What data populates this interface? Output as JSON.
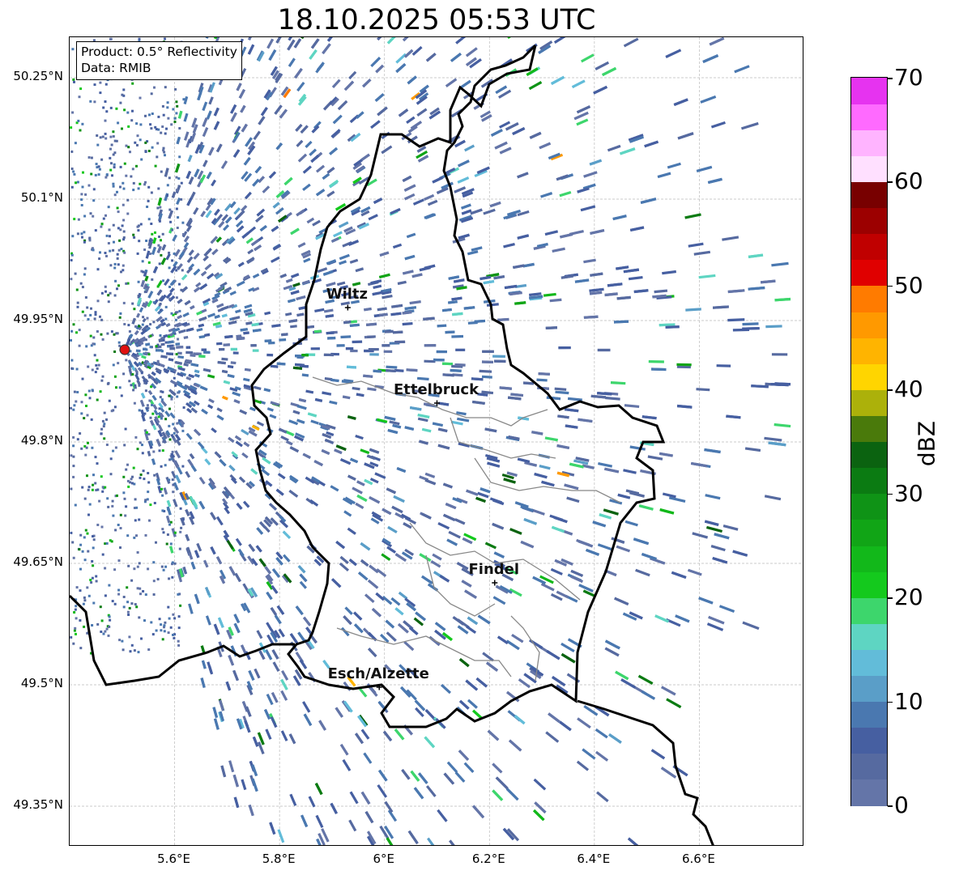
{
  "title": "18.10.2025 05:53 UTC",
  "info_box": {
    "product": "Product: 0.5° Reflectivity",
    "source": "Data: RMIB"
  },
  "axes": {
    "lon_ticks": [
      "5.6°E",
      "5.8°E",
      "6°E",
      "6.2°E",
      "6.4°E",
      "6.6°E"
    ],
    "lat_ticks": [
      "50.25°N",
      "50.1°N",
      "49.95°N",
      "49.8°N",
      "49.65°N",
      "49.5°N",
      "49.35°N"
    ],
    "lon_values": [
      5.6,
      5.8,
      6.0,
      6.2,
      6.4,
      6.6
    ],
    "lat_values": [
      50.25,
      50.1,
      49.95,
      49.8,
      49.65,
      49.5,
      49.35
    ],
    "lon_range": [
      5.4,
      6.8
    ],
    "lat_range": [
      49.3,
      50.3
    ],
    "grid": true
  },
  "radar_site": {
    "lon": 5.505,
    "lat": 49.914
  },
  "cities": [
    {
      "name": "Wiltz",
      "lon": 5.93,
      "lat": 49.966
    },
    {
      "name": "Ettelbruck",
      "lon": 6.1,
      "lat": 49.848
    },
    {
      "name": "Findel",
      "lon": 6.21,
      "lat": 49.626
    },
    {
      "name": "Esch/Alzette",
      "lon": 5.99,
      "lat": 49.497
    }
  ],
  "colorbar": {
    "label": "dBZ",
    "ticks": [
      "0",
      "10",
      "20",
      "30",
      "40",
      "50",
      "60",
      "70"
    ],
    "range": [
      0,
      70
    ],
    "colors": [
      "#6475a8",
      "#566aa0",
      "#465fa1",
      "#4a78b0",
      "#5a9ec8",
      "#62bcd9",
      "#5ed5c2",
      "#3dd66c",
      "#14c91d",
      "#12b81a",
      "#11a516",
      "#0f9316",
      "#0b7b12",
      "#0b6310",
      "#4a7a0b",
      "#acb10a",
      "#ffd500",
      "#ffb400",
      "#ff9900",
      "#ff7b00",
      "#e00000",
      "#c00000",
      "#9c0000",
      "#780000",
      "#ffe0ff",
      "#ffb4ff",
      "#ff6aff",
      "#e633f0"
    ]
  }
}
